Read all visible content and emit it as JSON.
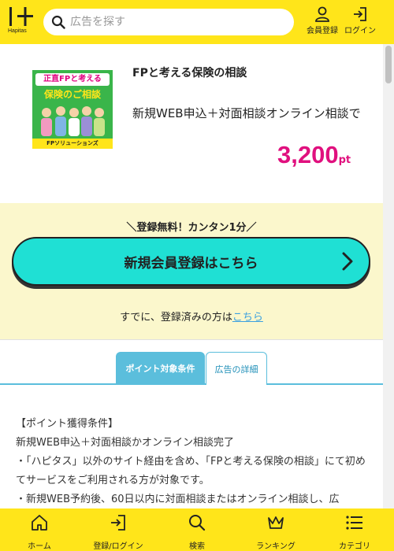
{
  "header": {
    "logo_text": "Hapitas",
    "search_placeholder": "広告を探す",
    "register_label": "会員登録",
    "login_label": "ログイン"
  },
  "offer": {
    "thumbnail": {
      "headline": "正直FPと考える",
      "subtitle": "保険のご相談",
      "company": "FPソリューションズ"
    },
    "title": "FPと考える保険の相談",
    "description": "新規WEB申込＋対面相談オンライン相談で",
    "points_value": "3,200",
    "points_unit": "pt"
  },
  "register": {
    "caption": "＼登録無料！カンタン1分／",
    "button_label": "新規会員登録はこちら",
    "already_text": "すでに、登録済みの方は",
    "already_link": "こちら"
  },
  "tabs": [
    {
      "label": "ポイント対象条件",
      "active": true
    },
    {
      "label": "広告の詳細",
      "active": false
    }
  ],
  "conditions": [
    "【ポイント獲得条件】",
    "新規WEB申込＋対面相談かオンライン相談完了",
    "・「ハピタス」以外のサイト経由を含め、「FPと考える保険の相談」にて初めてサービスをご利用される方が対象です。",
    "・新規WEB予約後、60日以内に対面相談またはオンライン相談し、広"
  ],
  "bottom_nav": [
    {
      "label": "ホーム",
      "icon": "home-icon"
    },
    {
      "label": "登録/ログイン",
      "icon": "login-icon"
    },
    {
      "label": "検索",
      "icon": "search-icon"
    },
    {
      "label": "ランキング",
      "icon": "crown-icon"
    },
    {
      "label": "カテゴリ",
      "icon": "list-icon"
    }
  ],
  "colors": {
    "brand_yellow": "#ffe51a",
    "cta_teal": "#1fe0d4",
    "points_pink": "#e0107e",
    "tab_blue": "#5bbedc",
    "register_bg": "#fbf7cc"
  }
}
